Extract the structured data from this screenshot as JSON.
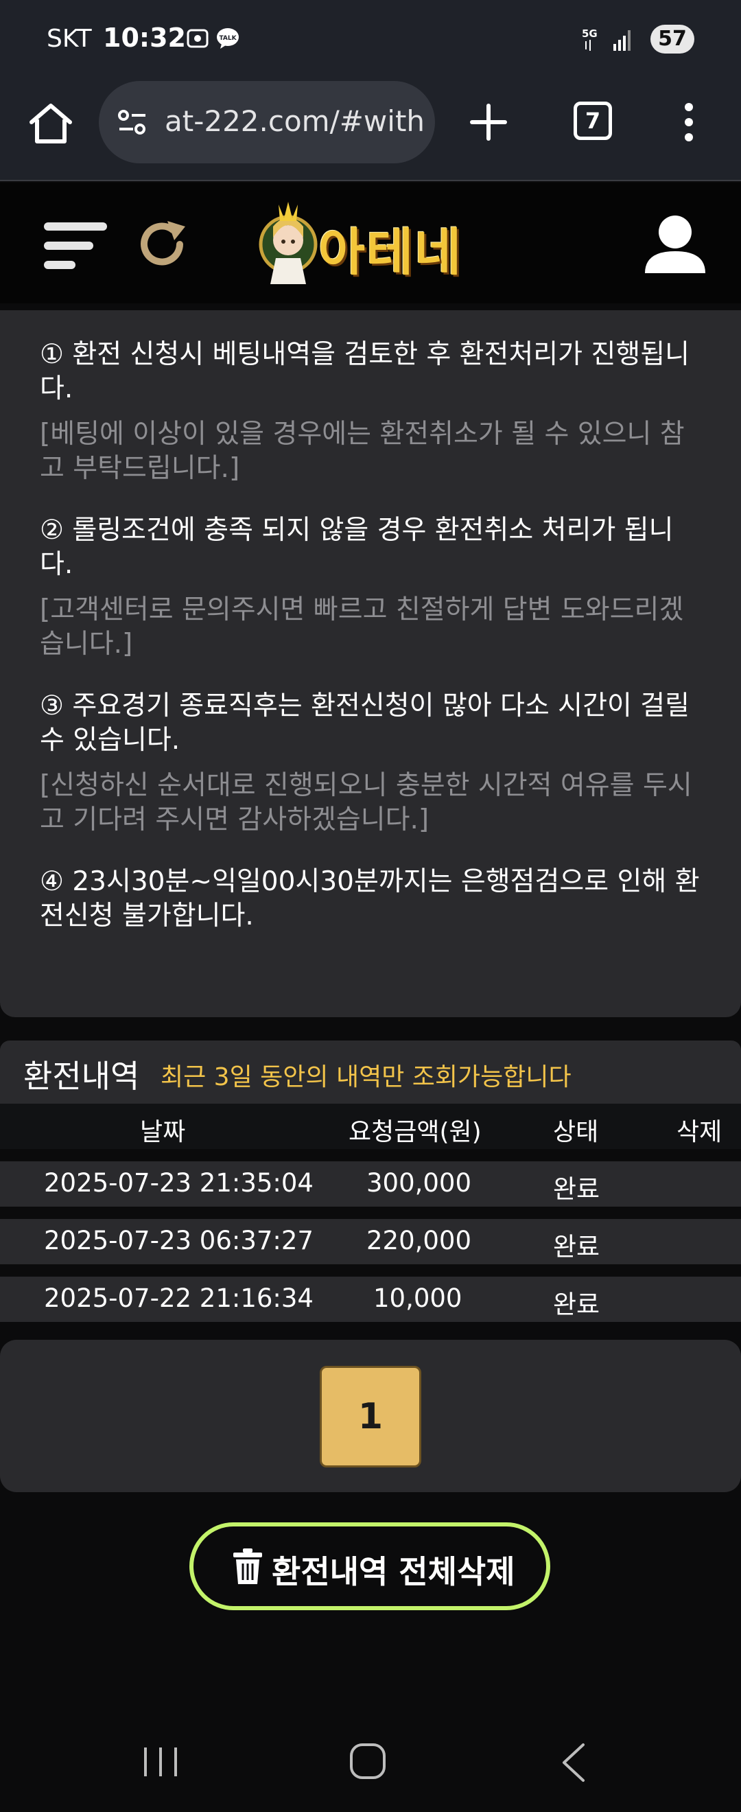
{
  "status": {
    "carrier": "SKT",
    "time": "10:32",
    "network": "5G",
    "battery": "57"
  },
  "browser": {
    "url": "at-222.com/#with",
    "tab_count": "7"
  },
  "site": {
    "logo_text": "아테네"
  },
  "notices": [
    {
      "main": "① 환전 신청시 베팅내역을 검토한 후 환전처리가 진행됩니다.",
      "sub": "[베팅에 이상이 있을 경우에는 환전취소가 될 수 있으니 참고 부탁드립니다.]"
    },
    {
      "main": "② 롤링조건에 충족 되지 않을 경우 환전취소 처리가 됩니다.",
      "sub": "[고객센터로 문의주시면 빠르고 친절하게 답변 도와드리겠습니다.]"
    },
    {
      "main": "③ 주요경기 종료직후는 환전신청이 많아 다소 시간이 걸릴 수 있습니다.",
      "sub": "[신청하신 순서대로 진행되오니 충분한 시간적 여유를 두시고 기다려 주시면 감사하겠습니다.]"
    },
    {
      "main": "④ 23시30분~익일00시30분까지는 은행점검으로 인해 환전신청 불가합니다.",
      "sub": ""
    }
  ],
  "history": {
    "title": "환전내역",
    "note": "최근 3일 동안의 내역만 조회가능합니다",
    "columns": [
      "날짜",
      "요청금액(원)",
      "상태",
      "삭제"
    ],
    "rows": [
      {
        "date": "2025-07-23 21:35:04",
        "amount": "300,000",
        "status": "완료"
      },
      {
        "date": "2025-07-23 06:37:27",
        "amount": "220,000",
        "status": "완료"
      },
      {
        "date": "2025-07-22 21:16:34",
        "amount": "10,000",
        "status": "완료"
      }
    ]
  },
  "pagination": {
    "current_page": "1"
  },
  "actions": {
    "delete_all_label": "환전내역 전체삭제"
  }
}
